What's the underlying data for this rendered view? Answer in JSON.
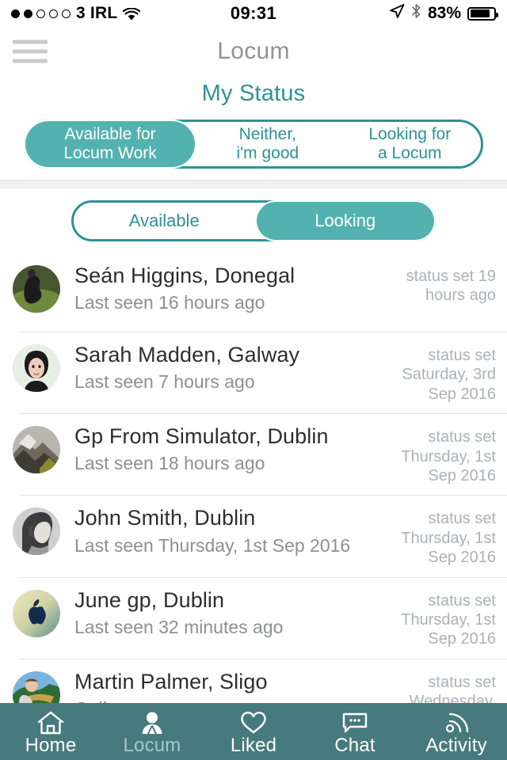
{
  "theme": {
    "accent_teal": "#2e9296",
    "fill_teal": "#53b2b0",
    "tabbar_teal": "#477a7c",
    "title_gray": "#8e9396",
    "meta_gray": "#8b9094",
    "stamp_gray": "#aab2b8"
  },
  "statusbar": {
    "carrier": "3 IRL",
    "signal_dots_filled": 2,
    "signal_dots_total": 5,
    "wifi_icon": "wifi-icon",
    "time": "09:31",
    "location_icon": "location-arrow-icon",
    "bluetooth_icon": "bluetooth-icon",
    "battery_percent": "83%",
    "battery_icon": "battery-icon"
  },
  "titlebar": {
    "menu_icon": "hamburger-menu-icon",
    "title": "Locum"
  },
  "status_section": {
    "heading": "My Status",
    "options": [
      {
        "line1": "Available for",
        "line2": "Locum Work",
        "selected": true
      },
      {
        "line1": "Neither,",
        "line2": "i'm good",
        "selected": false
      },
      {
        "line1": "Looking for",
        "line2": "a Locum",
        "selected": false
      }
    ]
  },
  "filter_toggle": {
    "options": [
      {
        "label": "Available",
        "selected": false
      },
      {
        "label": "Looking",
        "selected": true
      }
    ]
  },
  "list": {
    "rows": [
      {
        "avatar": "avatar-sean-higgins",
        "name": "Seán Higgins, Donegal",
        "seen": "Last seen 16 hours ago",
        "stamp": "status set  19 hours ago"
      },
      {
        "avatar": "avatar-sarah-madden",
        "name": "Sarah Madden, Galway",
        "seen": "Last seen 7 hours ago",
        "stamp": "status set Saturday, 3rd Sep 2016"
      },
      {
        "avatar": "avatar-gp-from-simulator",
        "name": "Gp From Simulator, Dublin",
        "seen": "Last seen 18 hours ago",
        "stamp": "status set Thursday, 1st Sep 2016"
      },
      {
        "avatar": "avatar-john-smith",
        "name": "John Smith, Dublin",
        "seen": "Last seen Thursday, 1st Sep 2016",
        "stamp": "status set Thursday, 1st Sep 2016"
      },
      {
        "avatar": "avatar-june-gp",
        "name": "June gp, Dublin",
        "seen": "Last seen 32 minutes ago",
        "stamp": "status set Thursday, 1st Sep 2016"
      },
      {
        "avatar": "avatar-martin-palmer",
        "name": "Martin Palmer, Sligo",
        "seen": "Online",
        "stamp": "status set Wednesday,"
      }
    ]
  },
  "tabbar": {
    "tabs": [
      {
        "label": "Home",
        "icon": "home-icon",
        "active": false
      },
      {
        "label": "Locum",
        "icon": "person-icon",
        "active": true
      },
      {
        "label": "Liked",
        "icon": "heart-icon",
        "active": false
      },
      {
        "label": "Chat",
        "icon": "chat-icon",
        "active": false
      },
      {
        "label": "Activity",
        "icon": "activity-icon",
        "active": false
      }
    ]
  }
}
